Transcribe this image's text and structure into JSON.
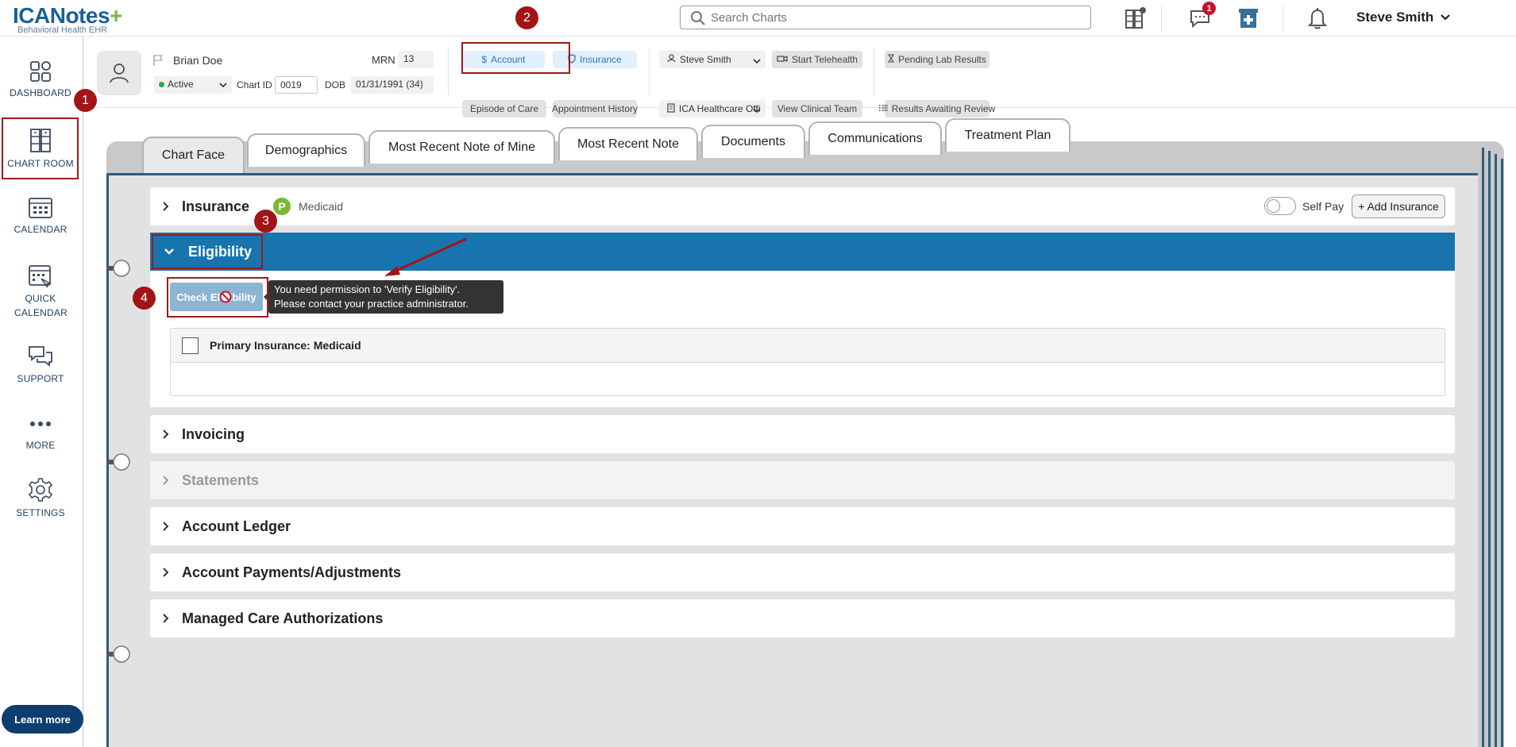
{
  "brand": {
    "name": "ICANotes",
    "plus": "+",
    "subtitle": "Behavioral Health EHR"
  },
  "search": {
    "placeholder": "Search Charts"
  },
  "notifications": {
    "messages_count": "1"
  },
  "user": {
    "name": "Steve Smith"
  },
  "sidebar": {
    "items": [
      {
        "label": "DASHBOARD"
      },
      {
        "label": "CHART ROOM"
      },
      {
        "label": "CALENDAR"
      },
      {
        "label": "QUICK CALENDAR"
      },
      {
        "label": "SUPPORT"
      },
      {
        "label": "MORE"
      },
      {
        "label": "SETTINGS"
      }
    ],
    "learn_more": "Learn more"
  },
  "patient": {
    "name": "Brian Doe",
    "status": "Active",
    "mrn_label": "MRN",
    "mrn": "13",
    "chart_id_label": "Chart ID",
    "chart_id": "0019",
    "dob_label": "DOB",
    "dob": "01/31/1991 (34)"
  },
  "header_buttons": {
    "account": "Account",
    "insurance": "Insurance",
    "episode_of_care": "Episode of Care",
    "appointment_history": "Appointment History",
    "provider": "Steve Smith",
    "office": "ICA Healthcare Offi",
    "start_telehealth": "Start Telehealth",
    "view_clinical_team": "View Clinical Team",
    "pending_lab_results": "Pending Lab Results",
    "results_awaiting_review": "Results Awaiting Review"
  },
  "tabs": [
    {
      "label": "Chart Face"
    },
    {
      "label": "Demographics"
    },
    {
      "label": "Most Recent Note of Mine"
    },
    {
      "label": "Most Recent Note"
    },
    {
      "label": "Documents"
    },
    {
      "label": "Communications"
    },
    {
      "label": "Treatment Plan"
    }
  ],
  "insurance_section": {
    "title": "Insurance",
    "badge": "P",
    "plan": "Medicaid",
    "self_pay_label": "Self Pay",
    "self_pay_on": false,
    "add_insurance": "+ Add Insurance"
  },
  "eligibility": {
    "title": "Eligibility",
    "check_button": "Check Eligibility",
    "tooltip_line1": "You need permission to 'Verify Eligibility'.",
    "tooltip_line2": "Please contact your practice administrator.",
    "primary_label": "Primary Insurance: Medicaid"
  },
  "sections": [
    {
      "title": "Invoicing",
      "disabled": false
    },
    {
      "title": "Statements",
      "disabled": true
    },
    {
      "title": "Account Ledger",
      "disabled": false
    },
    {
      "title": "Account Payments/Adjustments",
      "disabled": false
    },
    {
      "title": "Managed Care Authorizations",
      "disabled": false
    }
  ],
  "steps": [
    "1",
    "2",
    "3",
    "4"
  ],
  "colors": {
    "primary": "#1874ae",
    "brand": "#1a5f96",
    "highlight": "#9b1b1b",
    "step": "#a31416"
  }
}
